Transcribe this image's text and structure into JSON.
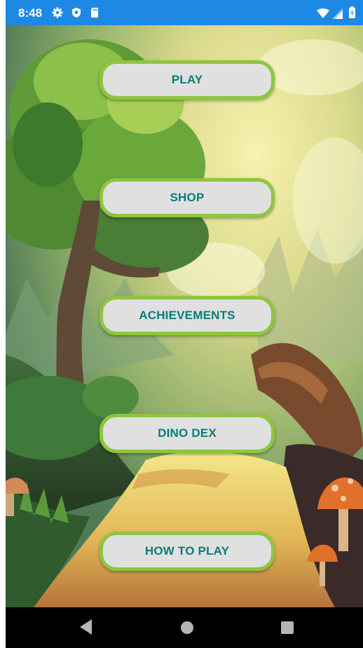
{
  "status_bar": {
    "time": "8:48",
    "icons": [
      "gear-icon",
      "shield-icon",
      "sd-card-icon",
      "wifi-icon",
      "cell-signal-icon",
      "battery-icon"
    ],
    "background_color": "#1e88e5"
  },
  "menu": {
    "buttons": [
      {
        "label": "PLAY"
      },
      {
        "label": "SHOP"
      },
      {
        "label": "ACHIEVEMENTS"
      },
      {
        "label": "DINO DEX"
      },
      {
        "label": "HOW TO PLAY"
      }
    ],
    "button_fill_color": "#e0e0e0",
    "button_border_color": "#8dc63f",
    "button_text_color": "#0a7b7b"
  },
  "navigation_bar": {
    "icons": [
      "back-icon",
      "home-icon",
      "recent-apps-icon"
    ]
  }
}
